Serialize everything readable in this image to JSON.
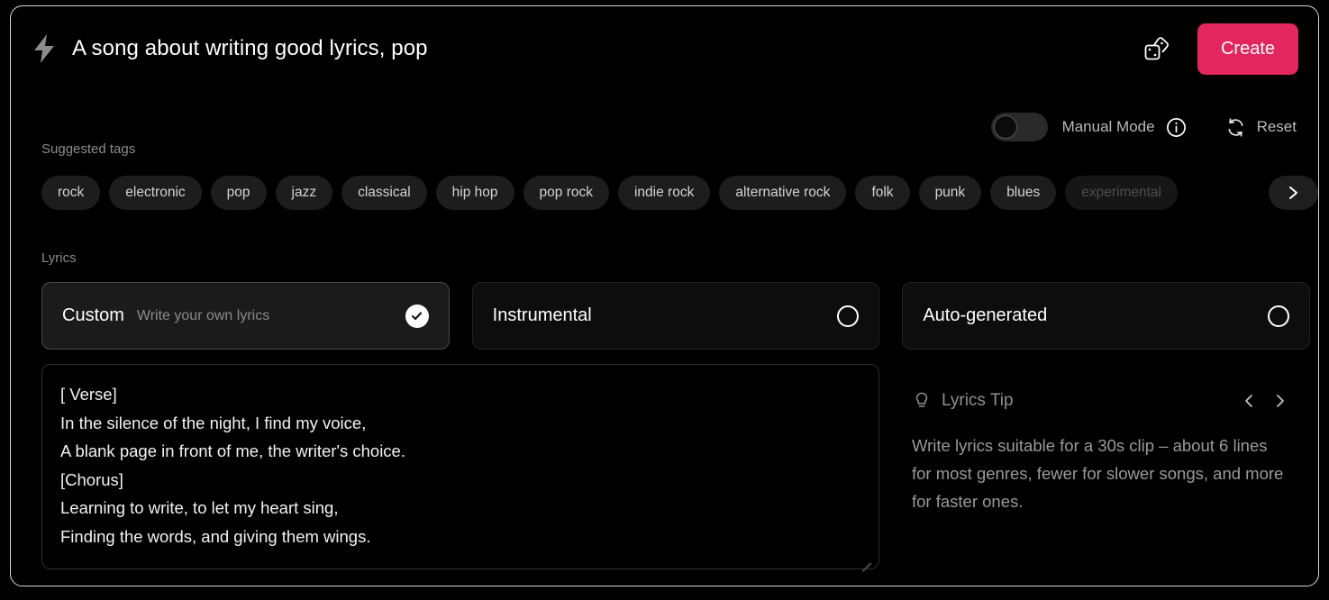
{
  "header": {
    "bolt_icon": "lightning-bolt-icon",
    "prompt_title": "A song about writing good lyrics, pop",
    "dice_icon": "dice-icon",
    "create_label": "Create",
    "create_color": "#e3265d"
  },
  "mode_row": {
    "toggle_state": "off",
    "manual_mode_label": "Manual Mode",
    "info_icon": "info-circle-icon",
    "reset_icon": "refresh-icon",
    "reset_label": "Reset"
  },
  "tags": {
    "label": "Suggested tags",
    "items": [
      {
        "label": "rock",
        "faded": false
      },
      {
        "label": "electronic",
        "faded": false
      },
      {
        "label": "pop",
        "faded": false
      },
      {
        "label": "jazz",
        "faded": false
      },
      {
        "label": "classical",
        "faded": false
      },
      {
        "label": "hip hop",
        "faded": false
      },
      {
        "label": "pop rock",
        "faded": false
      },
      {
        "label": "indie rock",
        "faded": false
      },
      {
        "label": "alternative rock",
        "faded": false
      },
      {
        "label": "folk",
        "faded": false
      },
      {
        "label": "punk",
        "faded": false
      },
      {
        "label": "blues",
        "faded": false
      },
      {
        "label": "experimental",
        "faded": true
      }
    ],
    "next_icon": "chevron-right-icon"
  },
  "lyrics": {
    "label": "Lyrics",
    "modes": [
      {
        "name": "Custom",
        "desc": "Write your own lyrics",
        "selected": true
      },
      {
        "name": "Instrumental",
        "desc": "",
        "selected": false
      },
      {
        "name": "Auto-generated",
        "desc": "",
        "selected": false
      }
    ],
    "editor_value": "[ Verse]\nIn the silence of the night, I find my voice,\nA blank page in front of me, the writer's choice.\n[Chorus]\nLearning to write, to let my heart sing,\nFinding the words, and giving them wings.",
    "editor_placeholder": "Write your own lyrics"
  },
  "tip": {
    "bulb_icon": "lightbulb-icon",
    "title": "Lyrics Tip",
    "prev_icon": "chevron-left-icon",
    "next_icon": "chevron-right-icon",
    "text": "Write lyrics suitable for a 30s clip – about 6 lines for most genres, fewer for slower songs, and more for faster ones."
  }
}
